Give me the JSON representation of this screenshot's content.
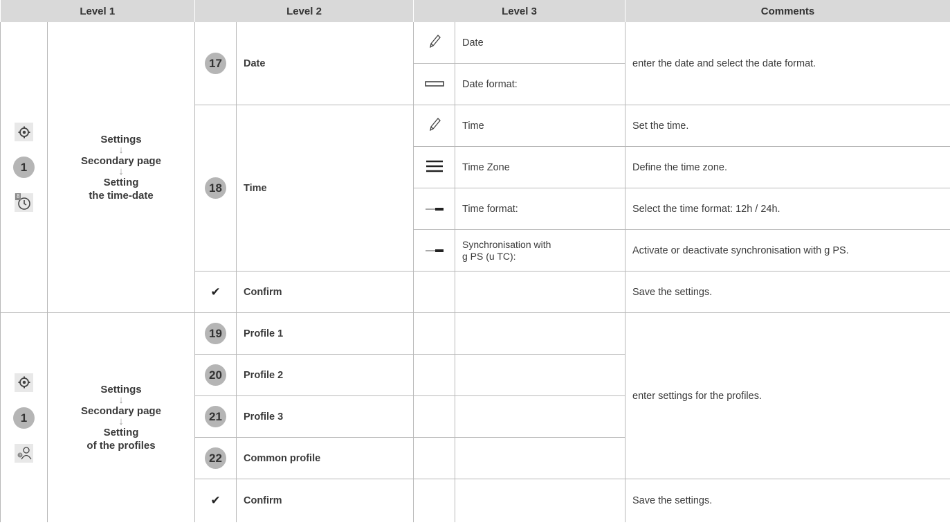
{
  "headers": {
    "level1": "Level 1",
    "level2": "Level 2",
    "level3": "Level 3",
    "comments": "Comments"
  },
  "group1": {
    "icon_number": "1",
    "clock_badge": "8",
    "path": [
      "Settings",
      "Secondary page",
      "Setting",
      "the time-date"
    ],
    "arrow": "↓",
    "date": {
      "number": "17",
      "label": "Date",
      "comment": "enter the date and select the date format."
    },
    "date_rows": [
      {
        "label": "Date"
      },
      {
        "label": "Date format:"
      }
    ],
    "time": {
      "number": "18",
      "label": "Time"
    },
    "time_rows": [
      {
        "label": "Time",
        "comment": "Set the time."
      },
      {
        "label": "Time Zone",
        "comment": "Define the time zone."
      },
      {
        "label": "Time format:",
        "comment": "Select the time format: 12h / 24h."
      },
      {
        "label_line1": "Synchronisation with",
        "label_line2": "g PS (u TC):",
        "comment": "Activate or deactivate synchronisation with g PS."
      }
    ],
    "confirm": {
      "check": "✔",
      "label": "Confirm",
      "comment": "Save the settings."
    }
  },
  "group2": {
    "icon_number": "1",
    "path": [
      "Settings",
      "Secondary page",
      "Setting",
      "of the profiles"
    ],
    "arrow": "↓",
    "profiles": [
      {
        "number": "19",
        "label": "Profile 1"
      },
      {
        "number": "20",
        "label": "Profile 2"
      },
      {
        "number": "21",
        "label": "Profile 3"
      },
      {
        "number": "22",
        "label": "Common profile"
      }
    ],
    "comment": "enter settings for the profiles.",
    "confirm": {
      "check": "✔",
      "label": "Confirm",
      "comment": "Save the settings."
    }
  }
}
